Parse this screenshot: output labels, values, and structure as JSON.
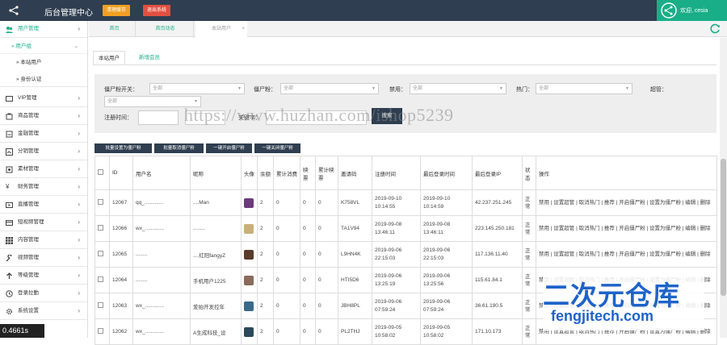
{
  "header": {
    "app_title": "后台管理中心",
    "btn_clear_cache": "清理缓存",
    "btn_logout": "退出系统",
    "user_greeting": "欢迎, cesia"
  },
  "sidebar": {
    "menus": [
      {
        "label": "用户管理",
        "icon": "users-icon"
      },
      {
        "label": "VIP管理",
        "icon": "vip-icon"
      },
      {
        "label": "商品管理",
        "icon": "goods-icon"
      },
      {
        "label": "金融管理",
        "icon": "finance-icon"
      },
      {
        "label": "分销管理",
        "icon": "distribution-icon"
      },
      {
        "label": "素材管理",
        "icon": "material-icon"
      },
      {
        "label": "财务管理",
        "icon": "yen-icon"
      },
      {
        "label": "直播管理",
        "icon": "live-icon"
      },
      {
        "label": "短视频管理",
        "icon": "video-icon"
      },
      {
        "label": "内容管理",
        "icon": "grid-icon"
      },
      {
        "label": "视频管理",
        "icon": "wrench-icon"
      },
      {
        "label": "等级管理",
        "icon": "level-icon"
      },
      {
        "label": "登录拉勤",
        "icon": "login-icon"
      },
      {
        "label": "系统设置",
        "icon": "gear-icon"
      }
    ],
    "sub_group": "用户组",
    "sub_items": [
      "本站用户",
      "身份认证"
    ],
    "version": "0.4661s"
  },
  "tabs": [
    {
      "label": "首页"
    },
    {
      "label": "首页动态"
    },
    {
      "label": "本站用户"
    }
  ],
  "subtabs": [
    "本站用户",
    "新增会员"
  ],
  "filters": {
    "f1_label": "僵尸粉开关：",
    "f2_label": "僵尸粉：",
    "f3_label": "禁用：",
    "f4_label": "热门：",
    "f5_label": "超管：",
    "select_all": "全部",
    "time_label": "注册时间：",
    "keyword_label": "关键字：",
    "search_btn": "搜索"
  },
  "actions": [
    "批量设置为僵尸粉",
    "批量取消僵尸粉",
    "一键开启僵尸粉",
    "一键关闭僵尸粉"
  ],
  "table": {
    "headers": [
      "ID",
      "用户名",
      "昵称",
      "头像",
      "余额",
      "累计消费",
      "映票",
      "累计映票",
      "邀请码",
      "注册时间",
      "最后登录时间",
      "最后登录IP",
      "状态",
      "操作"
    ],
    "rows": [
      {
        "id": "12067",
        "username": "qq_.............",
        "nickname": "....Man",
        "balance": "2",
        "spent": "0",
        "votes": "0",
        "votes_total": "0",
        "code": "K758VL",
        "reg": "2019-09-10 10:14:55",
        "last": "2019-09-10 10:14:59",
        "ip": "42.237.251.245",
        "state": "正常",
        "ops": "禁用 | 设置超管 | 取消热门 | 推荐 | 开启僵尸粉 | 设置为僵尸粉 | 编辑 | 删除",
        "avatar_color": "#6a3a7a"
      },
      {
        "id": "12066",
        "username": "wx_.............",
        "nickname": "........",
        "balance": "2",
        "spent": "0",
        "votes": "0",
        "votes_total": "0",
        "code": "TA1V94",
        "reg": "2019-09-08 13:46:11",
        "last": "2019-09-08 13:46:11",
        "ip": "223.145.250.181",
        "state": "正常",
        "ops": "禁用 | 设置超管 | 取消热门 | 推荐 | 开启僵尸粉 | 设置为僵尸粉 | 编辑 | 删除",
        "avatar_color": "#c8b078"
      },
      {
        "id": "12065",
        "username": "........",
        "nickname": "....红阳fangyZ",
        "balance": "2",
        "spent": "0",
        "votes": "0",
        "votes_total": "0",
        "code": "L9HN4K",
        "reg": "2019-09-06 22:15:03",
        "last": "2019-09-06 22:15:03",
        "ip": "117.136.11.40",
        "state": "正常",
        "ops": "禁用 | 设置超管 | 取消热门 | 推荐 | 开启僵尸粉 | 设置为僵尸粉 | 编辑 | 删除",
        "avatar_color": "#5a3a2a"
      },
      {
        "id": "12064",
        "username": "........",
        "nickname": "手机用户1225",
        "balance": "2",
        "spent": "0",
        "votes": "0",
        "votes_total": "0",
        "code": "HTI5D6",
        "reg": "2019-09-06 13:25:19",
        "last": "2019-09-06 13:25:56",
        "ip": "115.61.84.1",
        "state": "正常",
        "ops": "禁用 | 设置超管 | 取消热门 | 推荐 | 开启僵尸粉 | 设置为僵尸粉 | 编辑 | 删除",
        "avatar_color": "#8a6a5a"
      },
      {
        "id": "12063",
        "username": "wx_.............",
        "nickname": "爱拍开发控年",
        "balance": "2",
        "spent": "0",
        "votes": "0",
        "votes_total": "0",
        "code": "JBH8PL",
        "reg": "2019-09-06 07:59:24",
        "last": "2019-09-06 07:59:24",
        "ip": "36.61.190.5",
        "state": "正常",
        "ops": "禁用 | 设置超管 | 取消热门 | 推荐 | 开启僵尸粉 | 设置为僵尸粉 | 编辑 | 删除",
        "avatar_color": "#3a6a8a"
      },
      {
        "id": "12062",
        "username": "wx_.............",
        "nickname": "A生成科技_设",
        "balance": "2",
        "spent": "0",
        "votes": "0",
        "votes_total": "0",
        "code": "PL2THJ",
        "reg": "2019-09-05 10:58:02",
        "last": "2019-09-05 10:58:02",
        "ip": "171.10.173",
        "state": "正常",
        "ops": "禁用 | 设置超管 | 取消热门 | 推荐 | 开启僵尸粉 | 设置为僵尸粉 | 编辑 | 删除",
        "avatar_color": "#2a4a5a"
      }
    ]
  },
  "overlay": {
    "watermark": "https://www.huzhan.com/ishop5239",
    "brand_cn": "二次元仓库",
    "brand_en": "fengjitech.com"
  },
  "colors": {
    "topbar": "#2f3e50",
    "accent": "#1aae88",
    "btn_orange": "#f0a020",
    "btn_red": "#e05040"
  }
}
